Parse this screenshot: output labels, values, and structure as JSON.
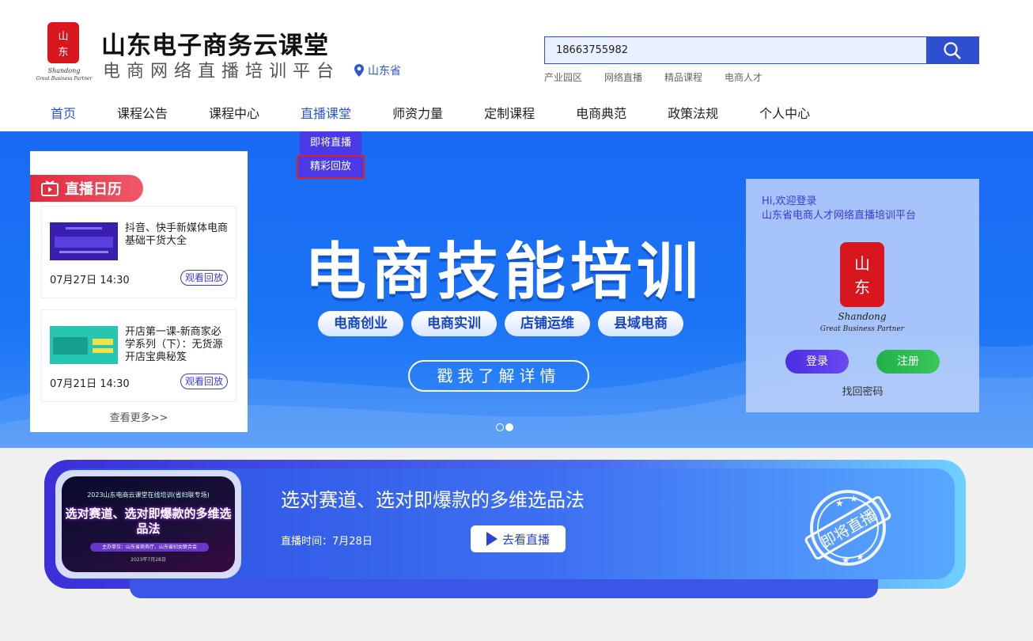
{
  "brand": {
    "title": "山东电子商务云课堂",
    "subtitle": "电商网络直播培训平台",
    "location": "山东省"
  },
  "search": {
    "value": "18663755982",
    "hot_links": [
      "产业园区",
      "网络直播",
      "精品课程",
      "电商人才"
    ]
  },
  "nav": [
    "首页",
    "课程公告",
    "课程中心",
    "直播课堂",
    "师资力量",
    "定制课程",
    "电商典范",
    "政策法规",
    "个人中心"
  ],
  "dropdown": [
    "即将直播",
    "精彩回放"
  ],
  "banner": {
    "title": "电商技能培训",
    "tags": [
      "电商创业",
      "电商实训",
      "店铺运维",
      "县域电商"
    ],
    "cta": "戳我了解详情"
  },
  "calendar": {
    "heading": "直播日历",
    "items": [
      {
        "title": "抖音、快手新媒体电商基础干货大全",
        "time": "07月27日 14:30",
        "action": "观看回放"
      },
      {
        "title": "开店第一课-新商家必学系列（下）：无货源开店宝典秘笈",
        "time": "07月21日 14:30",
        "action": "观看回放"
      }
    ],
    "more": "查看更多>>"
  },
  "login": {
    "hi": "Hi,欢迎登录",
    "platform": "山东省电商人才网络直播培训平台",
    "login_btn": "登录",
    "register_btn": "注册",
    "forgot": "找回密码"
  },
  "live": {
    "thumb_top": "2023山东电商云课堂在线培训(省妇联专场)",
    "thumb_main": "选对赛道、选对即爆款的多维选品法",
    "thumb_host": "主办单位：山东省商务厅、山东省妇女联合会",
    "thumb_date": "2023年7月28日",
    "title": "选对赛道、选对即爆款的多维选品法",
    "time": "直播时间：7月28日",
    "go": "去看直播",
    "stamp": "即将直播"
  }
}
